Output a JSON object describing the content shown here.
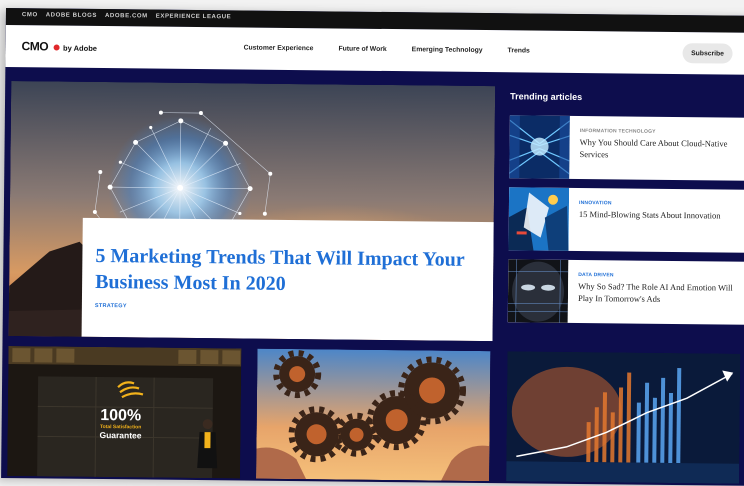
{
  "utility_links": [
    "CMO",
    "ADOBE BLOGS",
    "ADOBE.COM",
    "EXPERIENCE LEAGUE"
  ],
  "logo": {
    "mark": "CMO",
    "suffix": "by Adobe"
  },
  "nav": {
    "links": [
      "Customer Experience",
      "Future of Work",
      "Emerging Technology",
      "Trends"
    ],
    "subscribe_label": "Subscribe"
  },
  "hero": {
    "title": "5 Marketing Trends That Will Impact Your Business Most In 2020",
    "category": "STRATEGY",
    "image": "glowing-network-globe-at-dusk"
  },
  "trending": {
    "heading": "Trending articles",
    "items": [
      {
        "category": "INFORMATION TECHNOLOGY",
        "category_color": "#888888",
        "title": "Why You Should Care About Cloud-Native Services",
        "image": "server-aisle-blue-light"
      },
      {
        "category": "INNOVATION",
        "category_color": "#1f6fd6",
        "title": "15 Mind-Blowing Stats About Innovation",
        "image": "abstract-figure-illustration"
      },
      {
        "category": "DATA DRIVEN",
        "category_color": "#1f6fd6",
        "title": "Why So Sad? The Role AI And Emotion Will Play In Tomorrow's Ads",
        "image": "digital-face-closeup"
      }
    ]
  },
  "tiles": [
    {
      "image": "stage-speaker-guarantee",
      "overlay": {
        "big": "100%",
        "small1": "Total Satisfaction",
        "small2": "Guarantee"
      }
    },
    {
      "image": "hands-with-gears-sunset"
    },
    {
      "image": "business-chart-hologram"
    }
  ],
  "colors": {
    "navy": "#0d0d4d",
    "accent_blue": "#1f6fd6",
    "logo_red": "#e0282b"
  }
}
